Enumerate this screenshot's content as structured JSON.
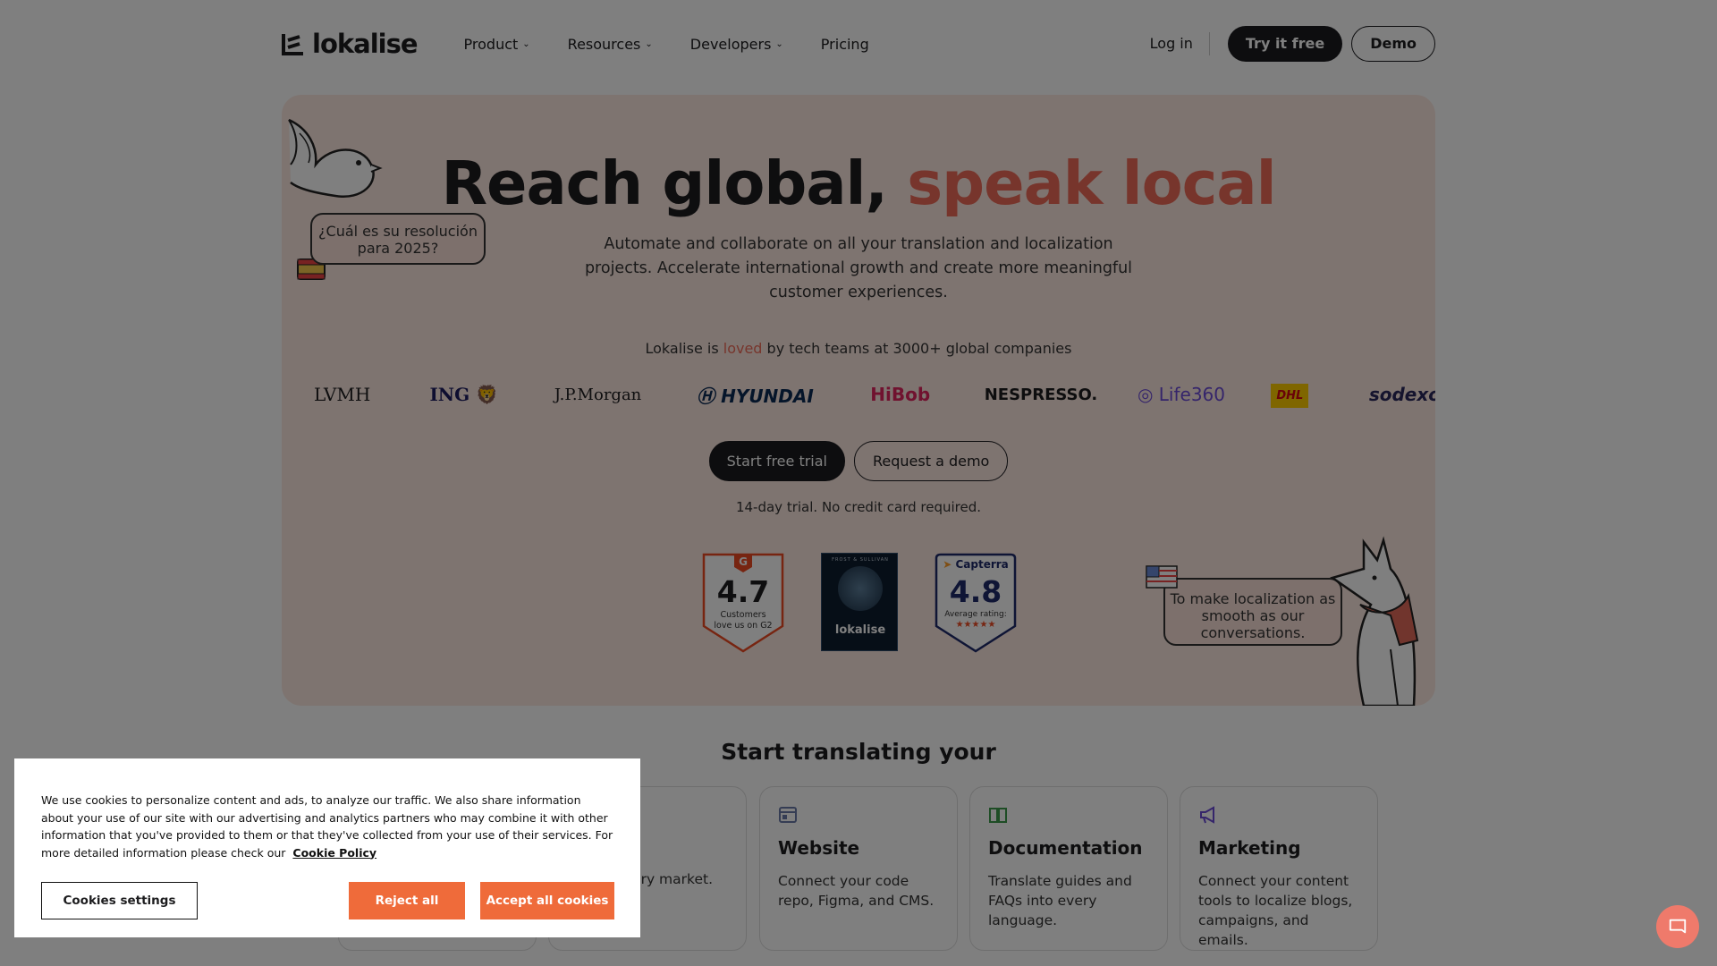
{
  "nav": {
    "logo_text": "lokalise",
    "menu": [
      {
        "label": "Product",
        "chevron": true
      },
      {
        "label": "Resources",
        "chevron": true
      },
      {
        "label": "Developers",
        "chevron": true
      },
      {
        "label": "Pricing",
        "chevron": false
      }
    ],
    "login": "Log in",
    "try_free": "Try it free",
    "demo": "Demo"
  },
  "hero": {
    "title_main": "Reach global,",
    "title_accent": "speak local",
    "subtitle": "Automate and collaborate on all your translation and localization projects. Accelerate international growth and create more meaningful customer experiences.",
    "loved_prefix": "Lokalise is",
    "loved_word": "loved",
    "loved_suffix": "by tech teams at 3000+ global companies",
    "brands": [
      "LVMH",
      "ING",
      "J.P.Morgan",
      "HYUNDAI",
      "HiBob",
      "NESPRESSO.",
      "Life360",
      "DHL",
      "sodexo"
    ],
    "cta_primary": "Start free trial",
    "cta_secondary": "Request a demo",
    "trial_note": "14-day trial. No credit card required.",
    "bubble_left": "¿Cuál es su resolución para 2025?",
    "bubble_right": "To make localization as smooth as our conversations.",
    "badge_g2": {
      "score": "4.7",
      "line1": "Customers",
      "line2": "love us on G2",
      "letter": "G"
    },
    "badge_frost": {
      "top": "FROST & SULLIVAN",
      "brand": "lokalise"
    },
    "badge_capterra": {
      "brand": "Capterra",
      "score": "4.8",
      "label": "Average rating:",
      "stars": "★★★★★"
    }
  },
  "section": {
    "title": "Start translating your",
    "cards": [
      {
        "title": "",
        "desc": ""
      },
      {
        "title": "",
        "desc": "mes for\nvery market."
      },
      {
        "title": "Website",
        "desc": "Connect your code repo, Figma, and CMS.",
        "icon": "website-icon"
      },
      {
        "title": "Documentation",
        "desc": "Translate guides and FAQs into every language.",
        "icon": "book-icon"
      },
      {
        "title": "Marketing",
        "desc": "Connect your content tools to localize blogs, campaigns, and emails.",
        "icon": "megaphone-icon"
      }
    ]
  },
  "cookie": {
    "text": "We use cookies to personalize content and ads, to analyze our traffic. We also share information about your use of our site with our advertising and analytics partners who may combine it with other information that you've provided to them or that they've collected from your use of their services. For more detailed information please check our",
    "link": "Cookie Policy",
    "settings": "Cookies settings",
    "reject": "Reject all",
    "accept": "Accept all cookies"
  },
  "colors": {
    "accent": "#ef6b58",
    "dark": "#1b1b1f",
    "hero_bg": "#fde8e1",
    "cookie_button": "#ef6b3a"
  }
}
